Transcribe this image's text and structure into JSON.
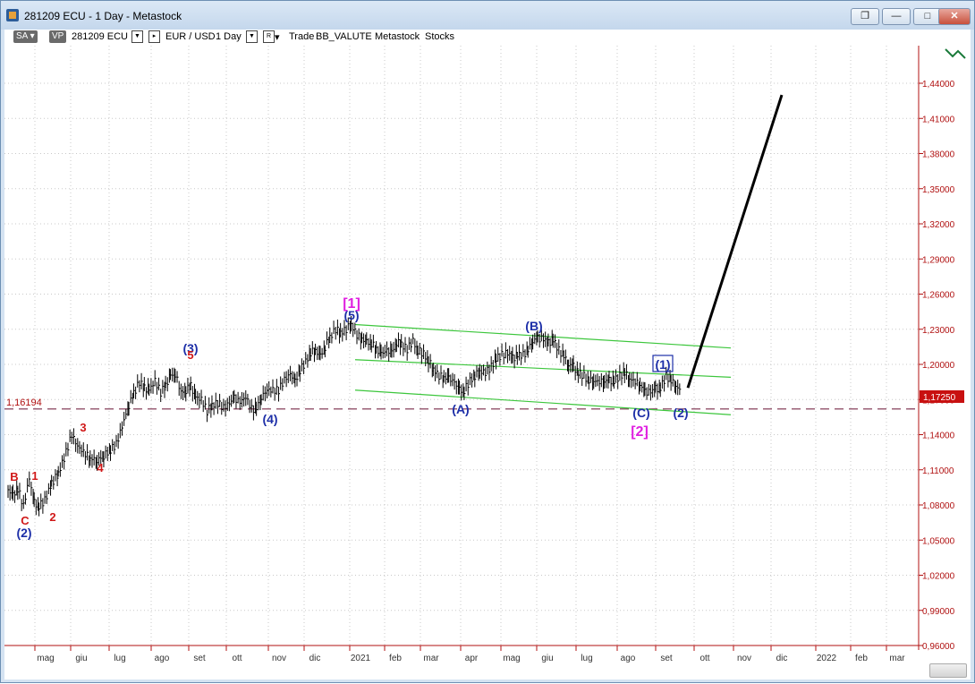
{
  "window": {
    "title": "281209 ECU - 1 Day - Metastock",
    "buttons": {
      "restore": "❐",
      "minimize": "—",
      "maximize": "□",
      "close": "✕"
    }
  },
  "toolbar": {
    "sa": "SA",
    "vp": "VP",
    "symbol": "281209 ECU",
    "instrument": "EUR / USD",
    "period": "1 Day",
    "r_label": "R",
    "items": [
      "Trade",
      "BB_VALUTE",
      "Metastock",
      "Stocks"
    ]
  },
  "chart_data": {
    "type": "bar",
    "instrument": "EUR / USD",
    "y_ticks": [
      "1,44000",
      "1,41000",
      "1,38000",
      "1,35000",
      "1,32000",
      "1,29000",
      "1,26000",
      "1,23000",
      "1,20000",
      "1,17000",
      "1,14000",
      "1,11000",
      "1,08000",
      "1,05000",
      "1,02000",
      "0,99000",
      "0,96000"
    ],
    "x_ticks": [
      "mag",
      "giu",
      "lug",
      "ago",
      "set",
      "ott",
      "nov",
      "dic",
      "2021",
      "feb",
      "mar",
      "apr",
      "mag",
      "giu",
      "lug",
      "ago",
      "set",
      "ott",
      "nov",
      "dic",
      "2022",
      "feb",
      "mar"
    ],
    "current_price_label": "1,17250",
    "horizontal_level_label": "1,16194",
    "horizontal_level": 1.16194,
    "price_path": [
      [
        0,
        1.093
      ],
      [
        5,
        1.088
      ],
      [
        10,
        1.094
      ],
      [
        16,
        1.079
      ],
      [
        22,
        1.103
      ],
      [
        27,
        1.082
      ],
      [
        32,
        1.079
      ],
      [
        38,
        1.084
      ],
      [
        45,
        1.098
      ],
      [
        52,
        1.107
      ],
      [
        58,
        1.12
      ],
      [
        66,
        1.14
      ],
      [
        72,
        1.13
      ],
      [
        78,
        1.125
      ],
      [
        85,
        1.12
      ],
      [
        92,
        1.118
      ],
      [
        99,
        1.122
      ],
      [
        106,
        1.127
      ],
      [
        112,
        1.132
      ],
      [
        118,
        1.147
      ],
      [
        125,
        1.165
      ],
      [
        130,
        1.175
      ],
      [
        136,
        1.185
      ],
      [
        141,
        1.18
      ],
      [
        146,
        1.178
      ],
      [
        152,
        1.186
      ],
      [
        158,
        1.176
      ],
      [
        163,
        1.182
      ],
      [
        168,
        1.19
      ],
      [
        173,
        1.192
      ],
      [
        179,
        1.176
      ],
      [
        184,
        1.178
      ],
      [
        189,
        1.182
      ],
      [
        194,
        1.172
      ],
      [
        200,
        1.17
      ],
      [
        206,
        1.16
      ],
      [
        211,
        1.165
      ],
      [
        217,
        1.167
      ],
      [
        223,
        1.163
      ],
      [
        229,
        1.167
      ],
      [
        234,
        1.171
      ],
      [
        240,
        1.168
      ],
      [
        246,
        1.172
      ],
      [
        252,
        1.162
      ],
      [
        257,
        1.162
      ],
      [
        262,
        1.172
      ],
      [
        268,
        1.178
      ],
      [
        274,
        1.178
      ],
      [
        280,
        1.178
      ],
      [
        286,
        1.187
      ],
      [
        292,
        1.192
      ],
      [
        297,
        1.185
      ],
      [
        302,
        1.195
      ],
      [
        308,
        1.202
      ],
      [
        313,
        1.21
      ],
      [
        318,
        1.212
      ],
      [
        323,
        1.207
      ],
      [
        328,
        1.215
      ],
      [
        333,
        1.223
      ],
      [
        339,
        1.23
      ],
      [
        344,
        1.227
      ],
      [
        350,
        1.23
      ],
      [
        355,
        1.234
      ],
      [
        361,
        1.225
      ],
      [
        366,
        1.222
      ],
      [
        371,
        1.219
      ],
      [
        376,
        1.218
      ],
      [
        381,
        1.213
      ],
      [
        386,
        1.209
      ],
      [
        392,
        1.212
      ],
      [
        397,
        1.21
      ],
      [
        402,
        1.219
      ],
      [
        407,
        1.217
      ],
      [
        413,
        1.213
      ],
      [
        419,
        1.22
      ],
      [
        424,
        1.212
      ],
      [
        430,
        1.209
      ],
      [
        435,
        1.203
      ],
      [
        440,
        1.196
      ],
      [
        446,
        1.19
      ],
      [
        451,
        1.189
      ],
      [
        456,
        1.188
      ],
      [
        462,
        1.185
      ],
      [
        467,
        1.178
      ],
      [
        472,
        1.178
      ],
      [
        478,
        1.186
      ],
      [
        483,
        1.19
      ],
      [
        488,
        1.194
      ],
      [
        494,
        1.193
      ],
      [
        500,
        1.198
      ],
      [
        505,
        1.205
      ],
      [
        511,
        1.208
      ],
      [
        517,
        1.21
      ],
      [
        522,
        1.205
      ],
      [
        527,
        1.208
      ],
      [
        533,
        1.208
      ],
      [
        538,
        1.212
      ],
      [
        543,
        1.22
      ],
      [
        548,
        1.222
      ],
      [
        554,
        1.222
      ],
      [
        559,
        1.218
      ],
      [
        564,
        1.221
      ],
      [
        570,
        1.212
      ],
      [
        575,
        1.207
      ],
      [
        580,
        1.2
      ],
      [
        585,
        1.198
      ],
      [
        590,
        1.193
      ],
      [
        596,
        1.19
      ],
      [
        601,
        1.186
      ],
      [
        606,
        1.186
      ],
      [
        612,
        1.185
      ],
      [
        617,
        1.186
      ],
      [
        622,
        1.186
      ],
      [
        627,
        1.186
      ],
      [
        633,
        1.19
      ],
      [
        638,
        1.193
      ],
      [
        643,
        1.188
      ],
      [
        649,
        1.185
      ],
      [
        654,
        1.183
      ],
      [
        659,
        1.176
      ],
      [
        665,
        1.177
      ],
      [
        670,
        1.179
      ],
      [
        675,
        1.18
      ],
      [
        681,
        1.19
      ],
      [
        686,
        1.186
      ],
      [
        691,
        1.182
      ],
      [
        697,
        1.176
      ]
    ],
    "series": [
      {
        "name": "wave projection",
        "points": [
          [
            0,
            1.18
          ],
          [
            1,
            1.43
          ]
        ]
      }
    ],
    "channel_lines": [
      {
        "start": 1.234,
        "end": 1.214
      },
      {
        "start": 1.204,
        "end": 1.189
      },
      {
        "start": 1.178,
        "end": 1.157
      }
    ],
    "wave_labels_blue": [
      "(2)",
      "(3)",
      "(4)",
      "(5)",
      "(A)",
      "(B)",
      "(C)",
      "(2)"
    ],
    "wave_labels_boxed": [
      "(1)"
    ],
    "wave_labels_magenta": [
      "[1]",
      "[2]"
    ],
    "wave_labels_red": [
      "B",
      "C",
      "1",
      "2",
      "3",
      "4",
      "5"
    ]
  },
  "colors": {
    "grid": "#c8c8c8",
    "axis_text": "#b01010",
    "price_bars": "#000000",
    "channel": "#3cc63c",
    "level_line": "#7a2b4a",
    "price_tag_bg": "#c81010",
    "wave_blue": "#1d2fa8",
    "wave_red": "#d01818",
    "wave_magenta": "#e020e0",
    "projection": "#000000"
  }
}
